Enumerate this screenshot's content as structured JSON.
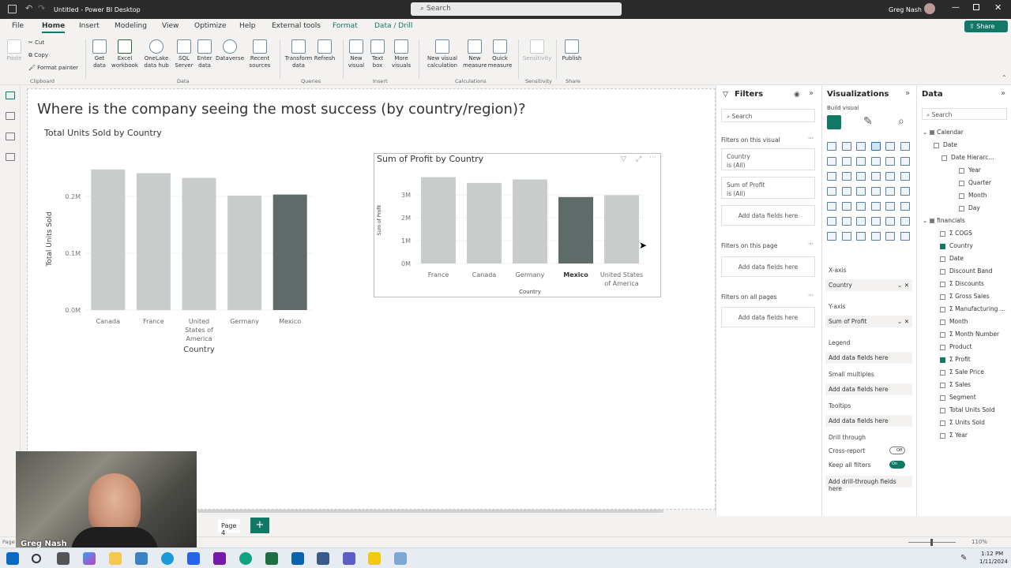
{
  "window": {
    "title": "Untitled - Power BI Desktop",
    "search_placeholder": "Search",
    "user": "Greg Nash"
  },
  "menu": {
    "tabs": [
      "File",
      "Home",
      "Insert",
      "Modeling",
      "View",
      "Optimize",
      "Help",
      "External tools",
      "Format",
      "Data / Drill"
    ],
    "active": "Home",
    "share": "Share"
  },
  "ribbon": {
    "clipboard": {
      "paste": "Paste",
      "cut": "Cut",
      "copy": "Copy",
      "format_painter": "Format painter",
      "group": "Clipboard"
    },
    "data": {
      "items": [
        "Get data",
        "Excel workbook",
        "OneLake data hub",
        "SQL Server",
        "Enter data",
        "Dataverse",
        "Recent sources"
      ],
      "group": "Data"
    },
    "queries": {
      "items": [
        "Transform data",
        "Refresh"
      ],
      "group": "Queries"
    },
    "insert": {
      "items": [
        "New visual",
        "Text box",
        "More visuals"
      ],
      "group": "Insert"
    },
    "calculations": {
      "items": [
        "New visual calculation",
        "New measure",
        "Quick measure"
      ],
      "group": "Calculations"
    },
    "sensitivity": {
      "items": [
        "Sensitivity"
      ],
      "group": "Sensitivity"
    },
    "share": {
      "items": [
        "Publish"
      ],
      "group": "Share"
    }
  },
  "page": {
    "title": "Where is the company seeing the most success (by country/region)?"
  },
  "chart_data": [
    {
      "type": "bar",
      "title": "Total Units Sold by Country",
      "xlabel": "Country",
      "ylabel": "Total Units Sold",
      "categories": [
        "Canada",
        "France",
        "United States of America",
        "Germany",
        "Mexico"
      ],
      "values": [
        247428,
        240931,
        232627,
        201494,
        203325
      ],
      "yticks": [
        "0.0M",
        "0.1M",
        "0.2M"
      ],
      "highlight": "Mexico",
      "colors": {
        "bar": "#c8ccca",
        "highlight": "#5f6b69"
      }
    },
    {
      "type": "bar",
      "title": "Sum of Profit by Country",
      "xlabel": "Country",
      "ylabel": "Sum of Profit",
      "categories": [
        "France",
        "Canada",
        "Germany",
        "Mexico",
        "United States of America"
      ],
      "values": [
        3780000,
        3530000,
        3680000,
        2910000,
        2990000
      ],
      "yticks": [
        "0M",
        "1M",
        "2M",
        "3M"
      ],
      "highlight": "Mexico",
      "colors": {
        "bar": "#c8ccca",
        "highlight": "#5f6b69"
      }
    }
  ],
  "filters": {
    "title": "Filters",
    "search": "Search",
    "on_visual": "Filters on this visual",
    "cards": [
      {
        "name": "Country",
        "state": "is (All)"
      },
      {
        "name": "Sum of Profit",
        "state": "is (All)"
      }
    ],
    "add": "Add data fields here",
    "on_page": "Filters on this page",
    "on_all": "Filters on all pages"
  },
  "visualizations": {
    "title": "Visualizations",
    "build": "Build visual",
    "xaxis": "X-axis",
    "xaxis_value": "Country",
    "yaxis": "Y-axis",
    "yaxis_value": "Sum of Profit",
    "legend": "Legend",
    "small_multiples": "Small multiples",
    "tooltips": "Tooltips",
    "add": "Add data fields here",
    "drill": "Drill through",
    "cross_report": "Cross-report",
    "cross_state": "Off",
    "keep_filters": "Keep all filters",
    "keep_state": "On",
    "add_drill": "Add drill-through fields here"
  },
  "data": {
    "title": "Data",
    "search": "Search",
    "fields": [
      {
        "label": "Calendar",
        "kind": "table"
      },
      {
        "label": "Date",
        "kind": "date"
      },
      {
        "label": "Date Hierarc...",
        "kind": "hier"
      },
      {
        "label": "Year",
        "kind": "level"
      },
      {
        "label": "Quarter",
        "kind": "level"
      },
      {
        "label": "Month",
        "kind": "level"
      },
      {
        "label": "Day",
        "kind": "level"
      },
      {
        "label": "financials",
        "kind": "table"
      },
      {
        "label": "COGS",
        "kind": "sigma"
      },
      {
        "label": "Country",
        "kind": "checked"
      },
      {
        "label": "Date",
        "kind": "field"
      },
      {
        "label": "Discount Band",
        "kind": "field"
      },
      {
        "label": "Discounts",
        "kind": "sigma"
      },
      {
        "label": "Gross Sales",
        "kind": "sigma"
      },
      {
        "label": "Manufacturing ...",
        "kind": "sigma"
      },
      {
        "label": "Month",
        "kind": "field"
      },
      {
        "label": "Month Number",
        "kind": "sigma"
      },
      {
        "label": "Product",
        "kind": "field"
      },
      {
        "label": "Profit",
        "kind": "checked-sigma"
      },
      {
        "label": "Sale Price",
        "kind": "sigma"
      },
      {
        "label": "Sales",
        "kind": "sigma"
      },
      {
        "label": "Segment",
        "kind": "field"
      },
      {
        "label": "Total Units Sold",
        "kind": "table-field"
      },
      {
        "label": "Units Sold",
        "kind": "sigma"
      },
      {
        "label": "Year",
        "kind": "sigma"
      }
    ]
  },
  "pages": {
    "tab": "Page 4",
    "add": "+"
  },
  "status": {
    "zoom": "110%",
    "page_label": "Page"
  },
  "webcam": {
    "name": "Greg Nash"
  },
  "clock": {
    "time": "1:12 PM",
    "date": "1/11/2024"
  }
}
